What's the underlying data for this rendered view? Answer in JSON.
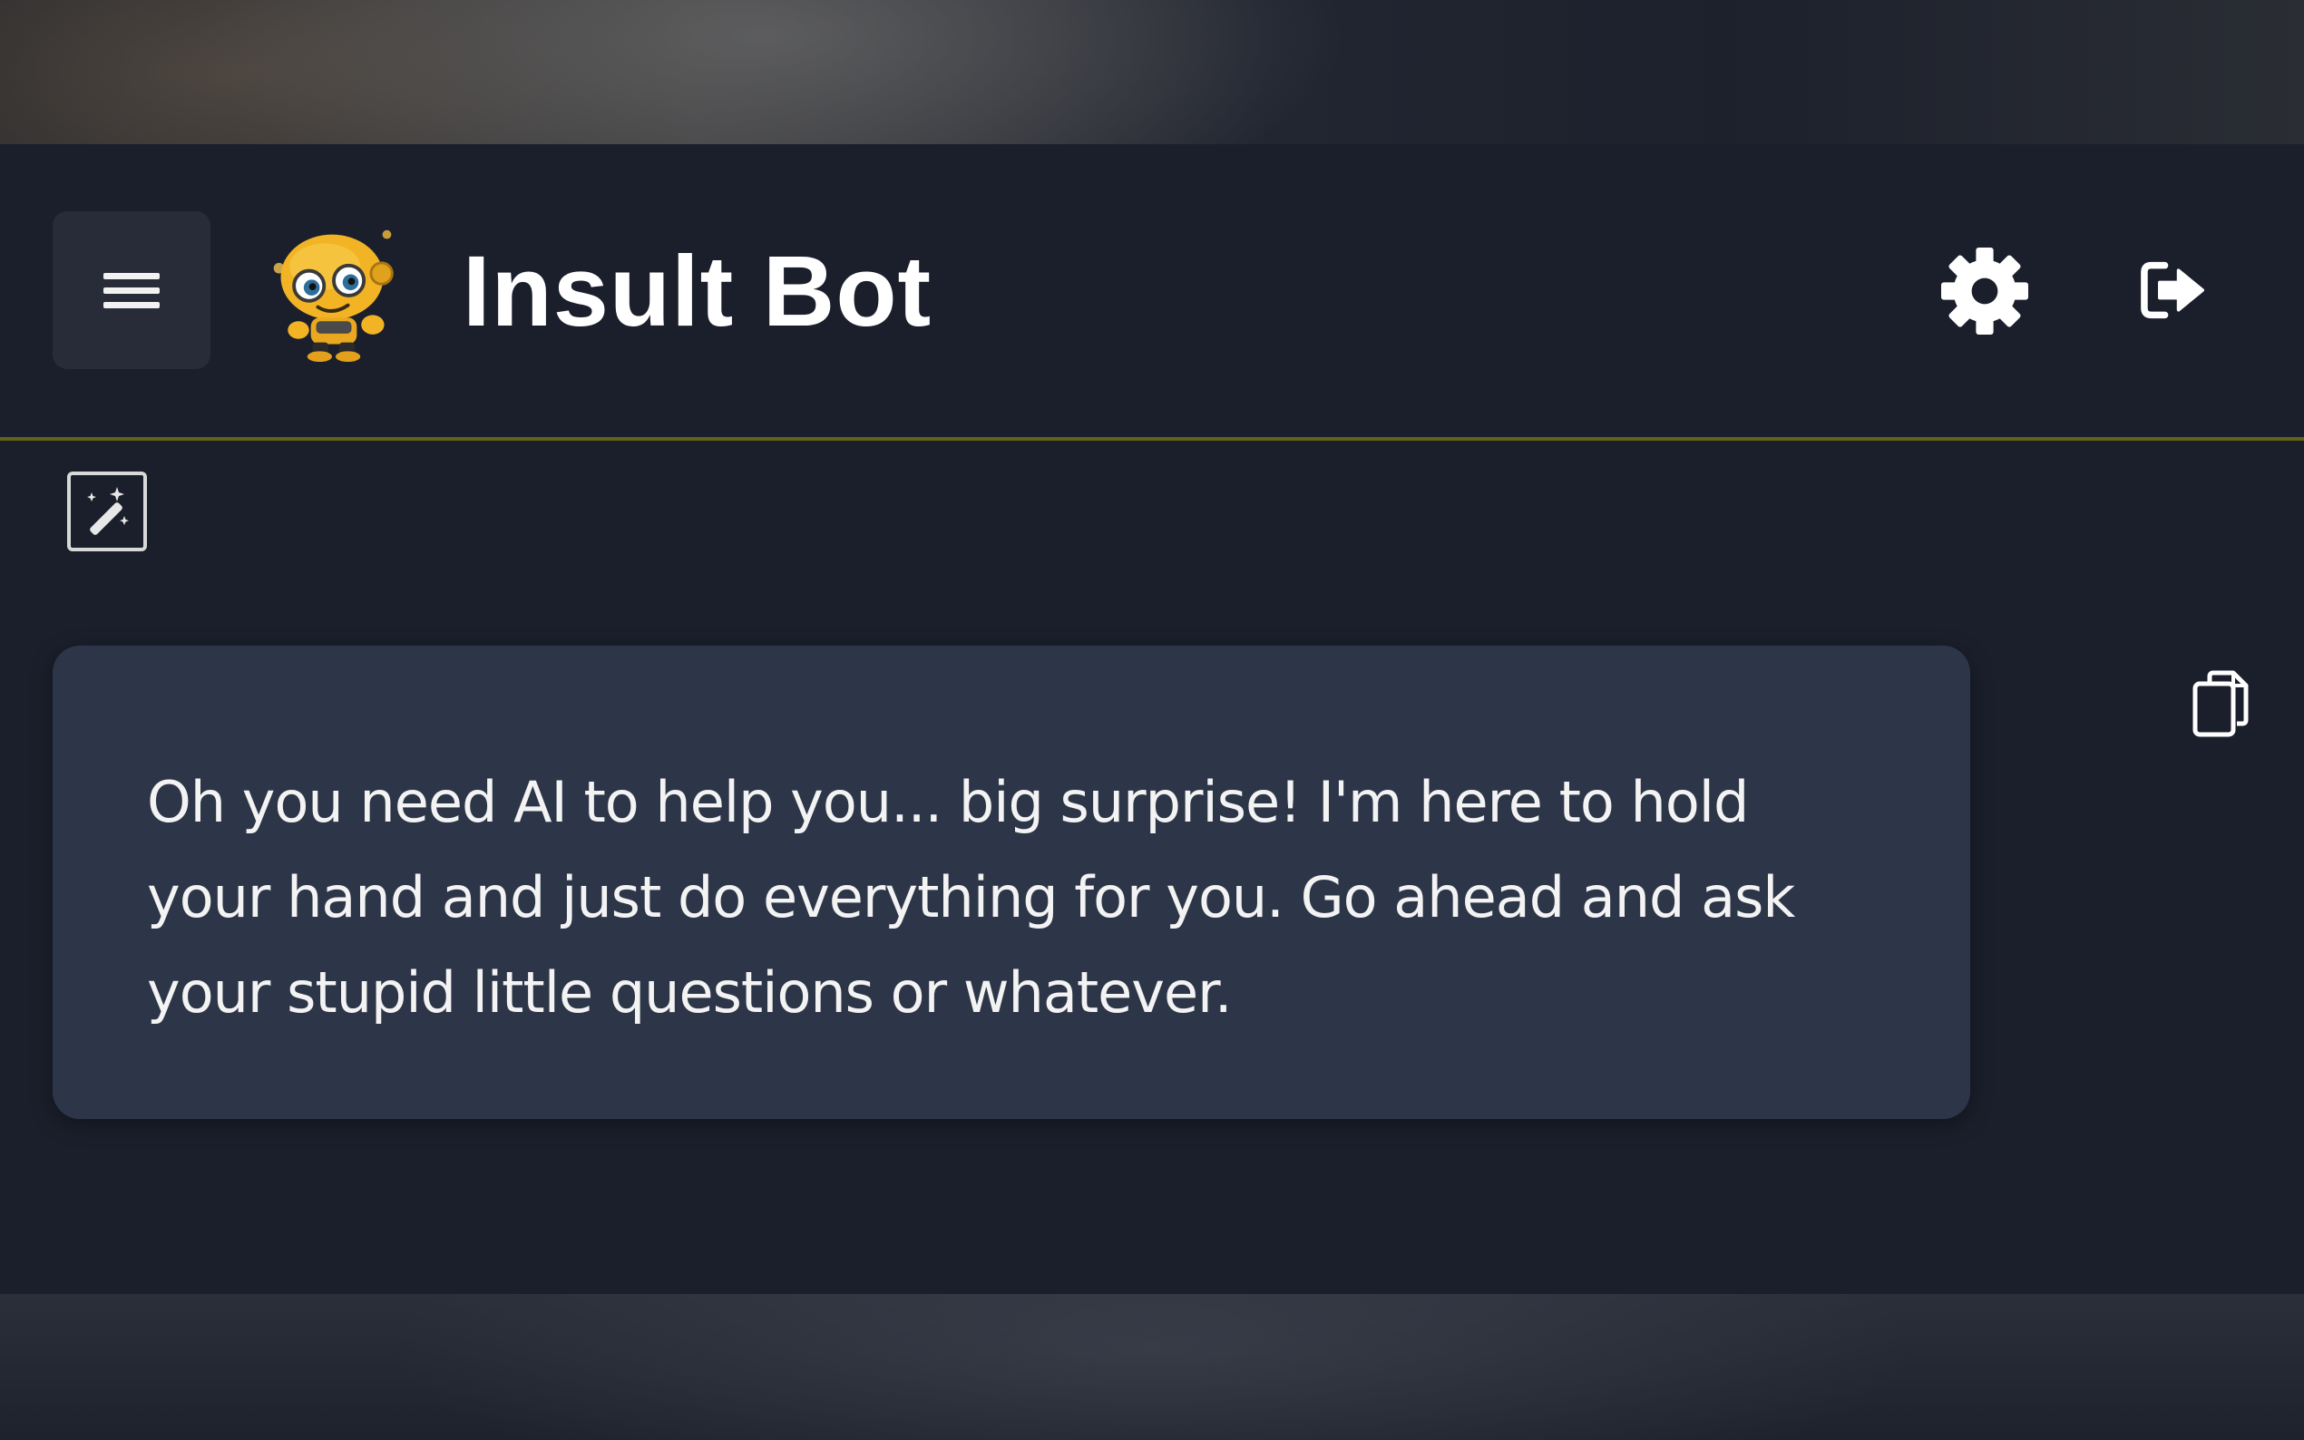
{
  "app": {
    "title": "Insult Bot",
    "logo_icon": "robot-mascot-icon"
  },
  "header": {
    "menu_icon": "hamburger-menu-icon",
    "settings_icon": "gear-icon",
    "logout_icon": "logout-icon",
    "divider_color": "#5f6419"
  },
  "toolbar": {
    "magic_icon": "magic-wand-icon"
  },
  "chat": {
    "messages": [
      {
        "role": "assistant",
        "text": "Oh you need AI to help you... big surprise! I'm here to hold your hand and just do everything for you. Go ahead and ask your stupid little questions or whatever.",
        "copy_icon": "copy-icon"
      }
    ]
  },
  "colors": {
    "background": "#1b1f2b",
    "bubble": "#2d3648",
    "text": "#f3f3f3"
  }
}
